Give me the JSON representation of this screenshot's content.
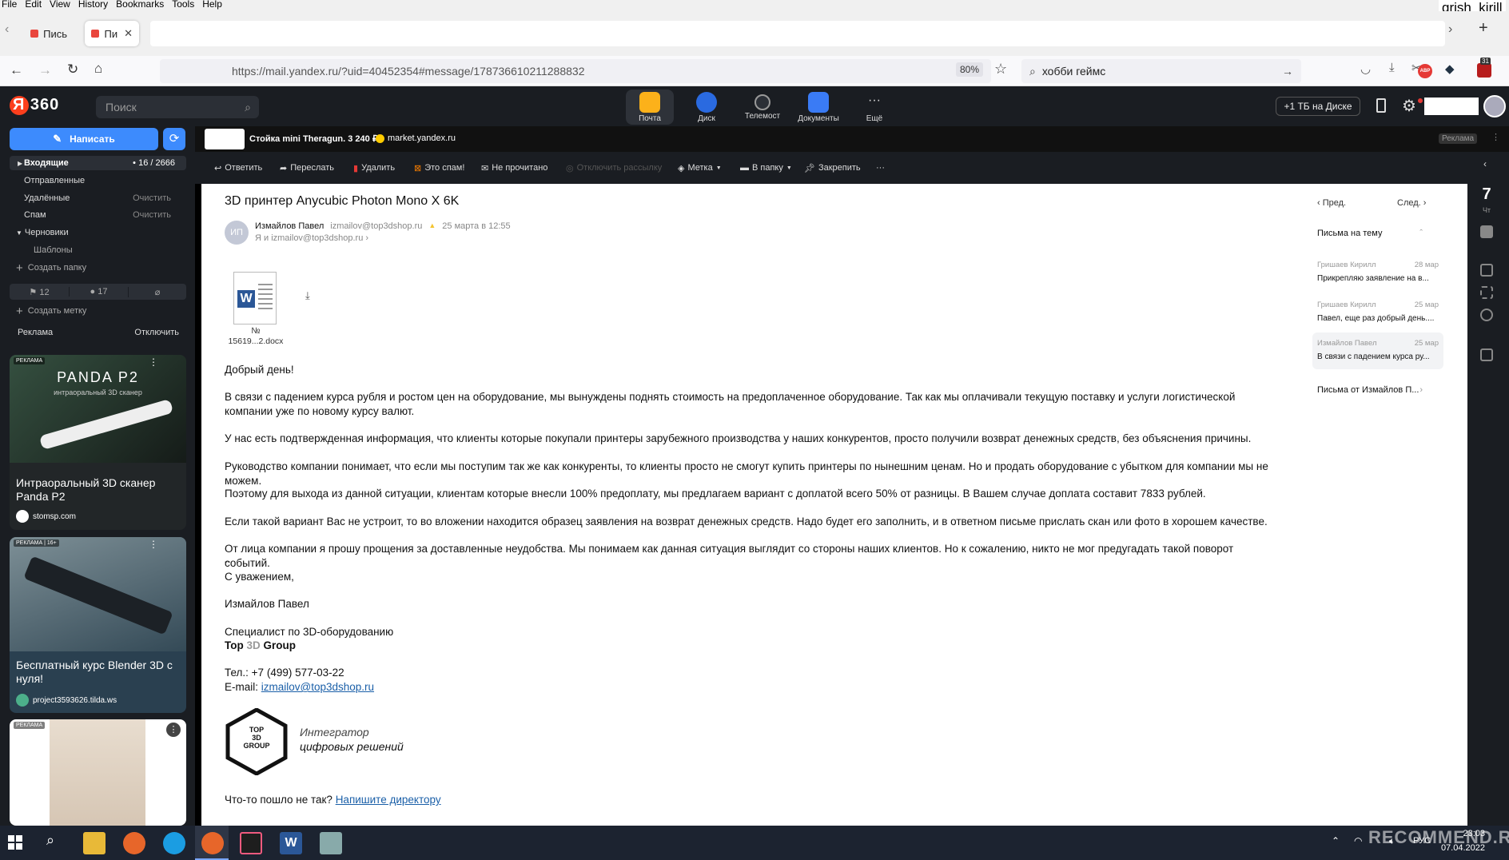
{
  "menubar": [
    "File",
    "Edit",
    "View",
    "History",
    "Bookmarks",
    "Tools",
    "Help"
  ],
  "user_corner": "grish_kirill",
  "tabs": [
    {
      "label": "Пись"
    },
    {
      "label": "Пи"
    }
  ],
  "url": "https://mail.yandex.ru/?uid=40452354#message/178736610211288832",
  "zoom": "80%",
  "browser_search": "хобби геймс",
  "ext_badge": "31",
  "header": {
    "logo": "Я 360",
    "search_placeholder": "Поиск",
    "services": [
      "Почта",
      "Диск",
      "Телемост",
      "Документы",
      "Ещё"
    ],
    "disk_promo": "+1 ТБ на Диске"
  },
  "sidebar": {
    "compose": "Написать",
    "folders": [
      {
        "label": "Входящие",
        "count": "16 / 2666"
      },
      {
        "label": "Отправленные",
        "action": ""
      },
      {
        "label": "Удалённые",
        "action": "Очистить"
      },
      {
        "label": "Спам",
        "action": "Очистить"
      },
      {
        "label": "Черновики",
        "action": ""
      },
      {
        "label": "Шаблоны",
        "action": ""
      }
    ],
    "create_folder": "Создать папку",
    "counters": {
      "flagged": "12",
      "unread": "17"
    },
    "create_label": "Создать метку",
    "ads_label": "Реклама",
    "ads_disable": "Отключить",
    "ads": [
      {
        "tag": "РЕКЛАМА",
        "brand": "PANDA P2",
        "subtitle": "интраоральный 3D сканер",
        "title": "Интраоральный 3D сканер Panda P2",
        "domain": "stomsp.com"
      },
      {
        "tag": "РЕКЛАМА | 16+",
        "title": "Бесплатный курс Blender 3D с нуля!",
        "domain": "project3593626.tilda.ws"
      },
      {
        "tag": "РЕКЛАМА"
      }
    ]
  },
  "adbar": {
    "text": "Стойка mini Theragun. 3 240 ₽",
    "domain": "market.yandex.ru",
    "label": "Реклама"
  },
  "toolbar": [
    "Ответить",
    "Переслать",
    "Удалить",
    "Это спам!",
    "Не прочитано",
    "Отключить рассылку",
    "Метка",
    "В папку",
    "Закрепить"
  ],
  "message": {
    "subject": "3D принтер Anycubic Photon Mono X 6K",
    "avatar": "ИП",
    "sender_name": "Измайлов Павел",
    "sender_email": "izmailov@top3dshop.ru",
    "date": "25 марта в 12:55",
    "recipients": "Я и izmailov@top3dshop.ru",
    "attachment_name": "№\n15619...2.docx",
    "greeting": "Добрый день!",
    "paragraphs": [
      "В связи с падением курса рубля и ростом цен на оборудование, мы вынуждены поднять стоимость на предоплаченное оборудование. Так как мы оплачивали текущую поставку и услуги логистической компании уже по новому курсу валют.",
      "У нас есть подтвержденная информация, что клиенты которые покупали принтеры зарубежного производства у наших конкурентов, просто получили возврат денежных средств, без объяснения причины.",
      "Руководство компании понимает, что если мы поступим так же как конкуренты, то клиенты просто не смогут купить принтеры по нынешним ценам. Но и продать оборудование с убытком для компании мы не можем.",
      "Поэтому для выхода из данной ситуации, клиентам которые внесли 100% предоплату, мы предлагаем вариант с доплатой всего 50% от разницы. В Вашем случае доплата составит 7833 рублей.",
      "Если такой вариант Вас не устроит, то во вложении находится образец заявления на возврат денежных средств. Надо будет его заполнить, и в ответном письме прислать скан или фото в хорошем качестве.",
      "От лица компании я прошу прощения за доставленные неудобства. Мы понимаем как данная ситуация выглядит со стороны наших клиентов. Но к сожалению, никто не мог предугадать такой поворот событий."
    ],
    "sig_dash": "--",
    "regards": "С уважением,",
    "sig_name": "Измайлов Павел",
    "sig_role": "Специалист по 3D-оборудованию",
    "sig_company_a": "Top ",
    "sig_company_b": "3D ",
    "sig_company_c": "Group",
    "sig_phone": "Тел.:  +7 (499) 577-03-22",
    "sig_email_label": "E-mail: ",
    "sig_email": "izmailov@top3dshop.ru",
    "logo_text": "TOP\n3D\nGROUP",
    "logo_tag1": "Интегратор",
    "logo_tag2": "цифровых решений",
    "footer_q": "Что-то пошло не так? ",
    "footer_link": "Напишите директору"
  },
  "thread": {
    "prev": "Пред.",
    "next": "След.",
    "title": "Письма на тему",
    "items": [
      {
        "from": "Гришаев Кирилл",
        "date": "28 мар",
        "snippet": "Прикрепляю заявление на в..."
      },
      {
        "from": "Гришаев Кирилл",
        "date": "25 мар",
        "snippet": "Павел, еще раз добрый день...."
      },
      {
        "from": "Измайлов Павел",
        "date": "25 мар",
        "snippet": "В связи с падением курса ру..."
      }
    ],
    "from_sender": "Письма от Измайлов П..."
  },
  "calendar": {
    "day": "7",
    "weekday": "Чт"
  },
  "taskbar": {
    "lang": "РУС",
    "time": "23:03",
    "date": "07.04.2022"
  },
  "watermark": "RECOMMEND.RU",
  "colors": {
    "accent": "#3d8bfd",
    "dark": "#1a1d22",
    "link": "#1a5fa8"
  }
}
